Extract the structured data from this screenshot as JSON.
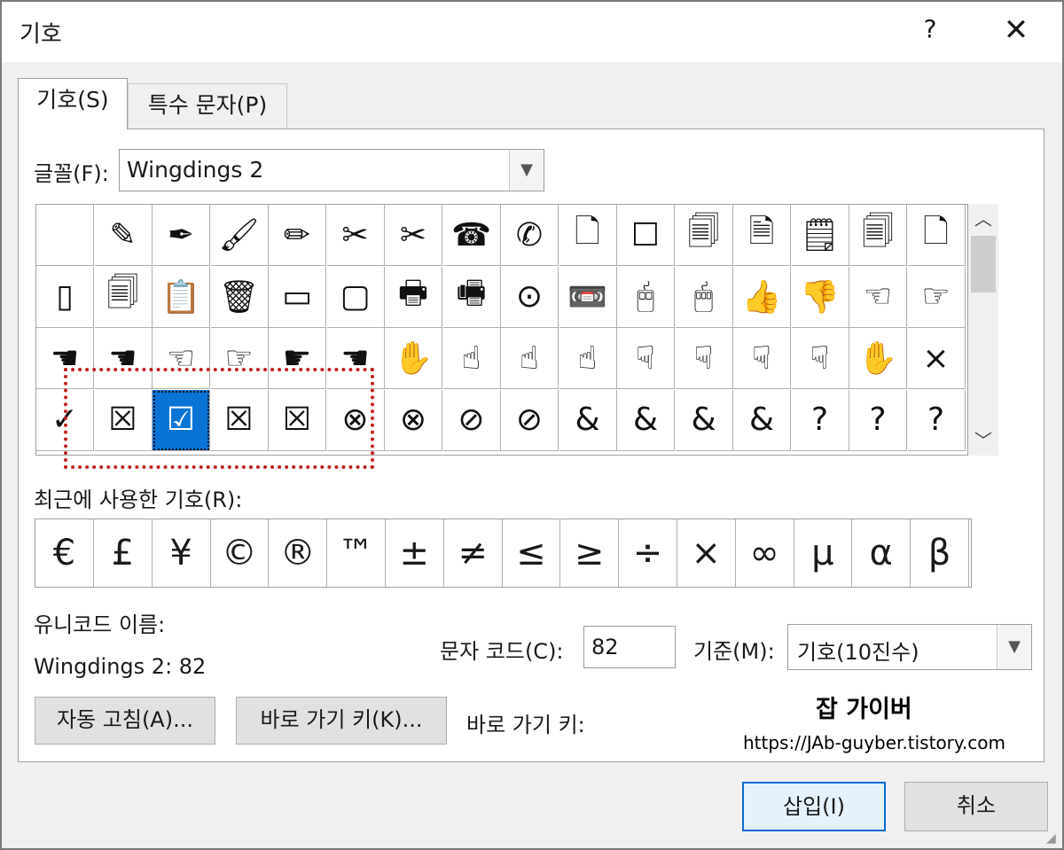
{
  "window": {
    "title": "기호",
    "help": "?",
    "close": "✕"
  },
  "tabs": [
    {
      "label": "기호(S)",
      "active": true
    },
    {
      "label": "특수 문자(P)",
      "active": false
    }
  ],
  "font": {
    "label": "글꼴(F):",
    "value": "Wingdings 2"
  },
  "symbol_grid": {
    "rows": [
      [
        "",
        "✎",
        "✒",
        "🖌",
        "✏",
        "✂",
        "✂",
        "☎",
        "✆",
        "🗋",
        "☐",
        "🗐",
        "🗎",
        "🗒",
        "🗐",
        "🗋"
      ],
      [
        "▯",
        "🗐",
        "📋",
        "🗑",
        "▭",
        "▢",
        "🖶",
        "🖷",
        "⊙",
        "📼",
        "🖰",
        "🖱",
        "👍",
        "👎",
        "☜",
        "☞"
      ],
      [
        "☚",
        "☚",
        "☜",
        "☞",
        "☛",
        "☚",
        "✋",
        "☝",
        "☝",
        "☝",
        "☟",
        "☟",
        "☟",
        "☟",
        "✋",
        "×"
      ],
      [
        "✓",
        "☒",
        "☑",
        "☒",
        "☒",
        "⊗",
        "⊗",
        "⊘",
        "⊘",
        "&",
        "&",
        "&",
        "&",
        "?",
        "?",
        "?"
      ]
    ],
    "selected_row": 3,
    "selected_col": 2
  },
  "recent": {
    "label": "최근에 사용한 기호(R):",
    "symbols": [
      "€",
      "£",
      "¥",
      "©",
      "®",
      "™",
      "±",
      "≠",
      "≤",
      "≥",
      "÷",
      "×",
      "∞",
      "μ",
      "α",
      "β"
    ]
  },
  "unicode": {
    "label": "유니코드 이름:",
    "name": "Wingdings 2: 82"
  },
  "char_code": {
    "label": "문자 코드(C):",
    "value": "82"
  },
  "base": {
    "label": "기준(M):",
    "value": "기호(10진수)"
  },
  "buttons": {
    "autocorrect": "자동 고침(A)...",
    "shortcut_key": "바로 가기 키(K)...",
    "shortcut_label": "바로 가기 키:",
    "insert": "삽입(I)",
    "cancel": "취소"
  },
  "watermark": {
    "title": "잡 가이버",
    "url": "https://JAb-guyber.tistory.com"
  }
}
